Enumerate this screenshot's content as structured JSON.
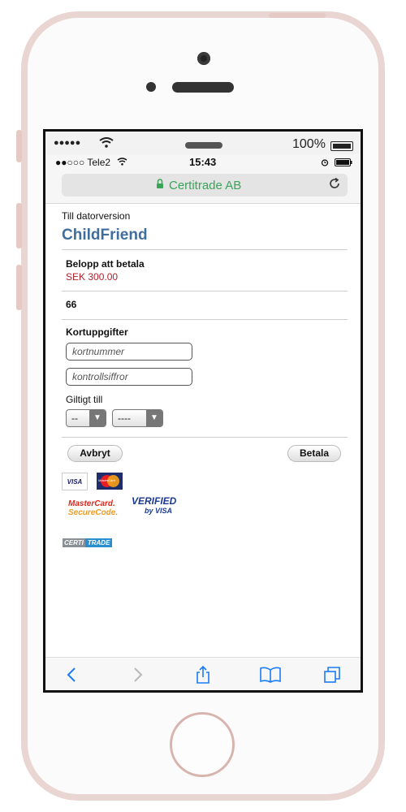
{
  "device": {
    "ghost_signal": "●●●●●",
    "ghost_battery": "100%"
  },
  "status_bar": {
    "carrier": "●●○○○ Tele2",
    "time": "15:43"
  },
  "browser": {
    "site_name": "Certitrade AB",
    "lock_icon": "lock-icon",
    "reload_icon": "reload-icon"
  },
  "page": {
    "desktop_link": "Till datorversion",
    "brand": "ChildFriend",
    "amount_label": "Belopp att betala",
    "amount_value": "SEK 300.00",
    "reference": "66",
    "card_section_label": "Kortuppgifter",
    "card_number_placeholder": "kortnummer",
    "cvc_placeholder": "kontrollsiffror",
    "valid_until_label": "Giltigt till",
    "month_select": "--",
    "year_select": "----",
    "cancel_button": "Avbryt",
    "pay_button": "Betala"
  },
  "logos": {
    "visa": "VISA",
    "mastercard": "MasterCard",
    "mc_securecode_line1": "MasterCard.",
    "mc_securecode_line2": "SecureCode.",
    "verified_line1": "VERIFIED",
    "verified_line2": "by VISA",
    "certitrade_part1": "CERTI",
    "certitrade_part2": "TRADE"
  },
  "colors": {
    "brand": "#3f6d9e",
    "amount": "#b0212b",
    "secure_site": "#3aa45a",
    "toolbar_icons": "#1a7cf5"
  }
}
